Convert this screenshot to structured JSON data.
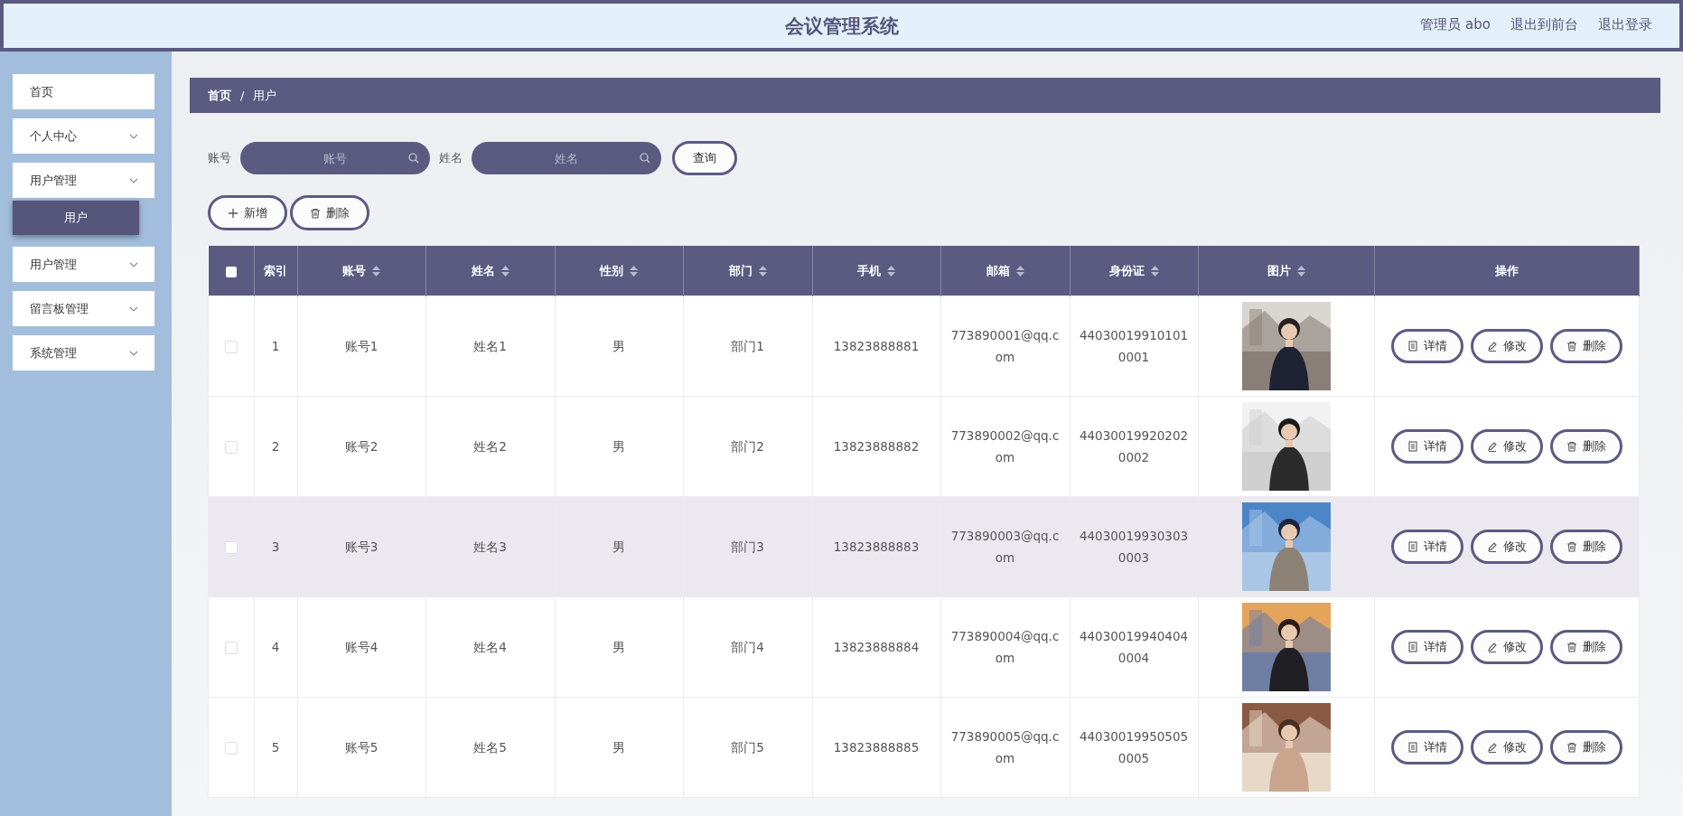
{
  "header": {
    "title": "会议管理系统",
    "links": [
      "管理员 abo",
      "退出到前台",
      "退出登录"
    ]
  },
  "sidebar": {
    "items": [
      {
        "label": "首页",
        "kind": "link"
      },
      {
        "label": "个人中心",
        "kind": "menu"
      },
      {
        "label": "用户管理",
        "kind": "menu",
        "children": [
          {
            "label": "用户",
            "selected": true
          }
        ]
      },
      {
        "label": "用户管理",
        "kind": "menu"
      },
      {
        "label": "留言板管理",
        "kind": "menu"
      },
      {
        "label": "系统管理",
        "kind": "menu"
      }
    ]
  },
  "breadcrumb": [
    "首页",
    "/",
    "用户"
  ],
  "search": {
    "fields": [
      {
        "label": "账号",
        "placeholder": "账号"
      },
      {
        "label": "姓名",
        "placeholder": "姓名"
      }
    ],
    "button": "查询"
  },
  "actions": [
    {
      "label": "新增",
      "kind": "add"
    },
    {
      "label": "删除",
      "kind": "delete"
    }
  ],
  "table": {
    "select_all_checked": false,
    "columns": [
      {
        "label": "索引",
        "sortable": false
      },
      {
        "label": "账号",
        "sortable": true
      },
      {
        "label": "姓名",
        "sortable": true
      },
      {
        "label": "性别",
        "sortable": true
      },
      {
        "label": "部门",
        "sortable": true
      },
      {
        "label": "手机",
        "sortable": true
      },
      {
        "label": "邮箱",
        "sortable": true
      },
      {
        "label": "身份证",
        "sortable": true
      },
      {
        "label": "图片",
        "sortable": true
      },
      {
        "label": "操作",
        "sortable": false
      }
    ],
    "rows": [
      {
        "checked": false,
        "highlighted": false,
        "cells": [
          "1",
          "账号1",
          "姓名1",
          "男",
          "部门1",
          "13823888881",
          "773890001@qq.com",
          "440300199101010001"
        ],
        "actions": [
          {
            "label": "详情",
            "kind": "detail"
          },
          {
            "label": "修改",
            "kind": "edit"
          },
          {
            "label": "删除",
            "kind": "delete"
          }
        ]
      },
      {
        "checked": false,
        "highlighted": false,
        "cells": [
          "2",
          "账号2",
          "姓名2",
          "男",
          "部门2",
          "13823888882",
          "773890002@qq.com",
          "440300199202020002"
        ],
        "actions": [
          {
            "label": "详情",
            "kind": "detail"
          },
          {
            "label": "修改",
            "kind": "edit"
          },
          {
            "label": "删除",
            "kind": "delete"
          }
        ]
      },
      {
        "checked": false,
        "highlighted": true,
        "cells": [
          "3",
          "账号3",
          "姓名3",
          "男",
          "部门3",
          "13823888883",
          "773890003@qq.com",
          "440300199303030003"
        ],
        "actions": [
          {
            "label": "详情",
            "kind": "detail"
          },
          {
            "label": "修改",
            "kind": "edit"
          },
          {
            "label": "删除",
            "kind": "delete"
          }
        ]
      },
      {
        "checked": false,
        "highlighted": false,
        "cells": [
          "4",
          "账号4",
          "姓名4",
          "男",
          "部门4",
          "13823888884",
          "773890004@qq.com",
          "440300199404040004"
        ],
        "actions": [
          {
            "label": "详情",
            "kind": "detail"
          },
          {
            "label": "修改",
            "kind": "edit"
          },
          {
            "label": "删除",
            "kind": "delete"
          }
        ]
      },
      {
        "checked": false,
        "highlighted": false,
        "cells": [
          "5",
          "账号5",
          "姓名5",
          "男",
          "部门5",
          "13823888885",
          "773890005@qq.com",
          "440300199505050005"
        ],
        "actions": [
          {
            "label": "详情",
            "kind": "detail"
          },
          {
            "label": "修改",
            "kind": "edit"
          },
          {
            "label": "删除",
            "kind": "delete"
          }
        ]
      }
    ]
  }
}
